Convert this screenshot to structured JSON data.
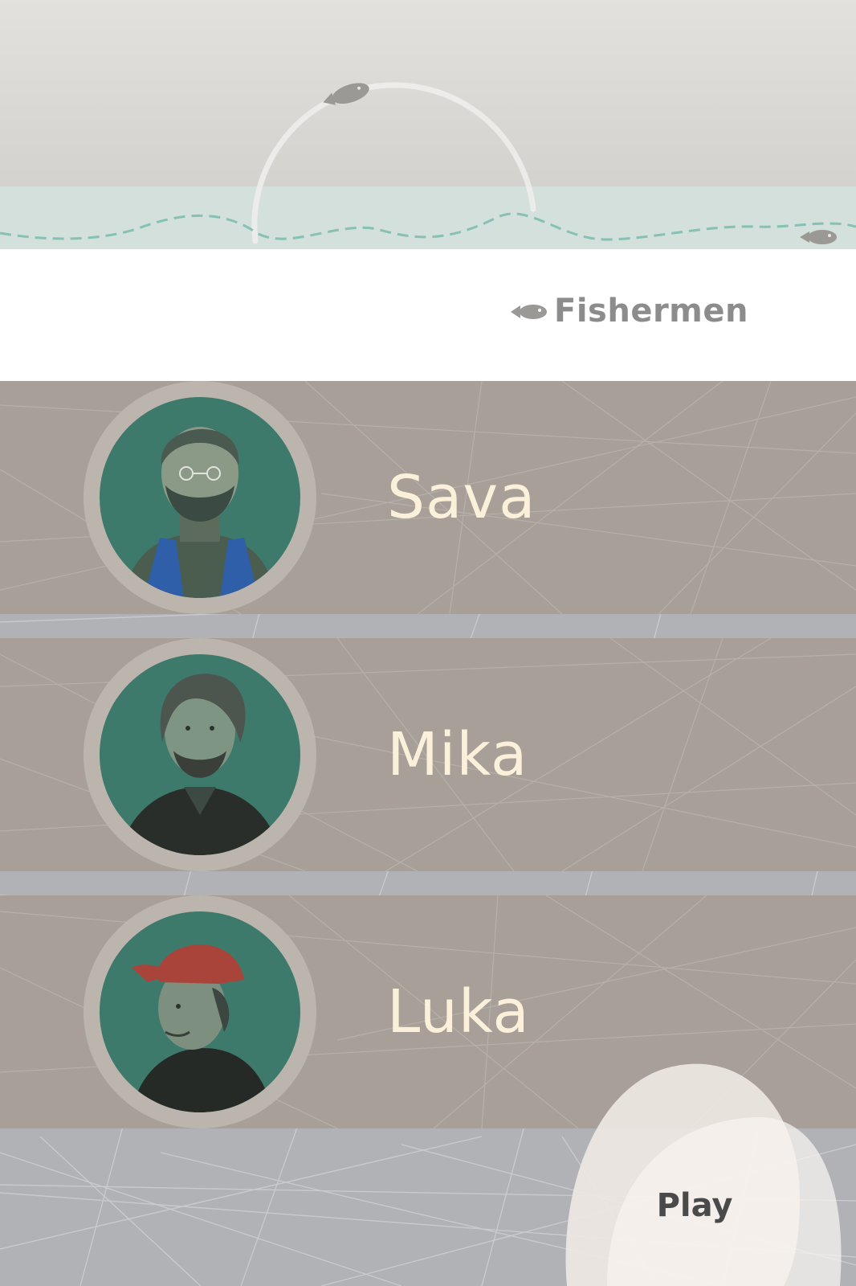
{
  "header": {
    "title": "Fishermen",
    "title_icon": "fish-icon"
  },
  "fishermen": [
    {
      "name": "Sava",
      "portrait": "sava-portrait"
    },
    {
      "name": "Mika",
      "portrait": "mika-portrait"
    },
    {
      "name": "Luka",
      "portrait": "luka-portrait"
    }
  ],
  "play_button": {
    "label": "Play"
  },
  "colors": {
    "sky": "#dcdad6",
    "sea": "#d3e0dc",
    "row": "#a79f98",
    "net": "#b1b2b6",
    "avatar_background": "#3e7a6c",
    "name_text": "#fbf1da",
    "title_text": "#8c8c8c",
    "play_text": "#4a4a4a"
  }
}
